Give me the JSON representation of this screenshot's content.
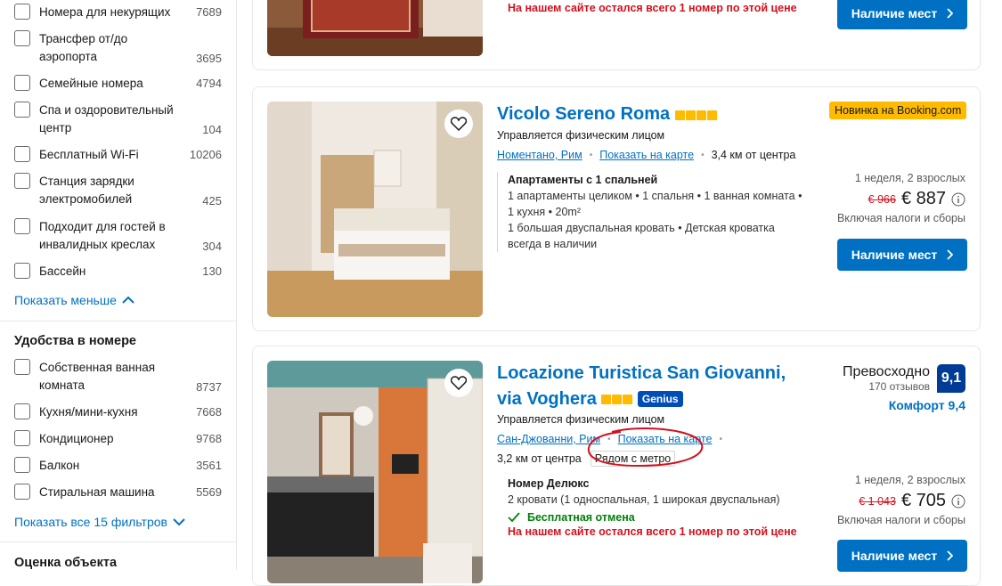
{
  "sidebar": {
    "filters_top": [
      {
        "label": "Номера для некурящих",
        "count": "7689"
      },
      {
        "label": "Трансфер от/до аэропорта",
        "count": "3695"
      },
      {
        "label": "Семейные номера",
        "count": "4794"
      },
      {
        "label": "Спа и оздоровительный центр",
        "count": "104"
      },
      {
        "label": "Бесплатный Wi-Fi",
        "count": "10206"
      },
      {
        "label": "Станция зарядки электромобилей",
        "count": "425"
      },
      {
        "label": "Подходит для гостей в инвалидных креслах",
        "count": "304"
      },
      {
        "label": "Бассейн",
        "count": "130"
      }
    ],
    "show_less": "Показать меньше",
    "room_section_title": "Удобства в номере",
    "room_filters": [
      {
        "label": "Собственная ванная комната",
        "count": "8737"
      },
      {
        "label": "Кухня/мини-кухня",
        "count": "7668"
      },
      {
        "label": "Кондиционер",
        "count": "9768"
      },
      {
        "label": "Балкон",
        "count": "3561"
      },
      {
        "label": "Стиральная машина",
        "count": "5569"
      }
    ],
    "show_all": "Показать все 15 фильтров",
    "rating_section_title": "Оценка объекта"
  },
  "card0": {
    "warning": "На нашем сайте остался всего 1 номер по этой цене",
    "button": "Наличие мест"
  },
  "card1": {
    "title": "Vicolo Sereno Roma",
    "managed": "Управляется физическим лицом",
    "district": "Номентано, Рим",
    "map_link": "Показать на карте",
    "distance": "3,4 км от центра",
    "badge": "Новинка на Booking.com",
    "room_title": "Апартаменты с 1 спальней",
    "room_line1": "1 апартаменты целиком • 1 спальня • 1 ванная комната •",
    "room_line2": "1 кухня • 20m²",
    "room_line3": "1 большая двуспальная кровать • Детская кроватка",
    "room_line4": "всегда в наличии",
    "stay": "1 неделя, 2 взрослых",
    "old_price": "€ 966",
    "price": "€ 887",
    "taxes": "Включая налоги и сборы",
    "button": "Наличие мест",
    "stars": 4
  },
  "card2": {
    "title_line1": "Locazione Turistica San Giovanni,",
    "title_line2": "via Voghera",
    "genius": "Genius",
    "managed": "Управляется физическим лицом",
    "district": "Сан-Джованни, Рим",
    "map_link": "Показать на карте",
    "distance": "3,2 км от центра",
    "metro": "Рядом с метро",
    "rating_word": "Превосходно",
    "reviews": "170 отзывов",
    "score": "9,1",
    "comfort": "Комфорт 9,4",
    "room_title": "Номер Делюкс",
    "room_beds": "2 кровати (1 односпальная, 1 широкая двуспальная)",
    "free_cancel": "Бесплатная отмена",
    "warning": "На нашем сайте остался всего 1 номер по этой цене",
    "stay": "1 неделя, 2 взрослых",
    "old_price": "€ 1 043",
    "price": "€ 705",
    "taxes": "Включая налоги и сборы",
    "button": "Наличие мест",
    "stars": 3
  },
  "colors": {
    "accent": "#0071c2",
    "badge": "#febb02",
    "annotation": "#d4111e"
  }
}
